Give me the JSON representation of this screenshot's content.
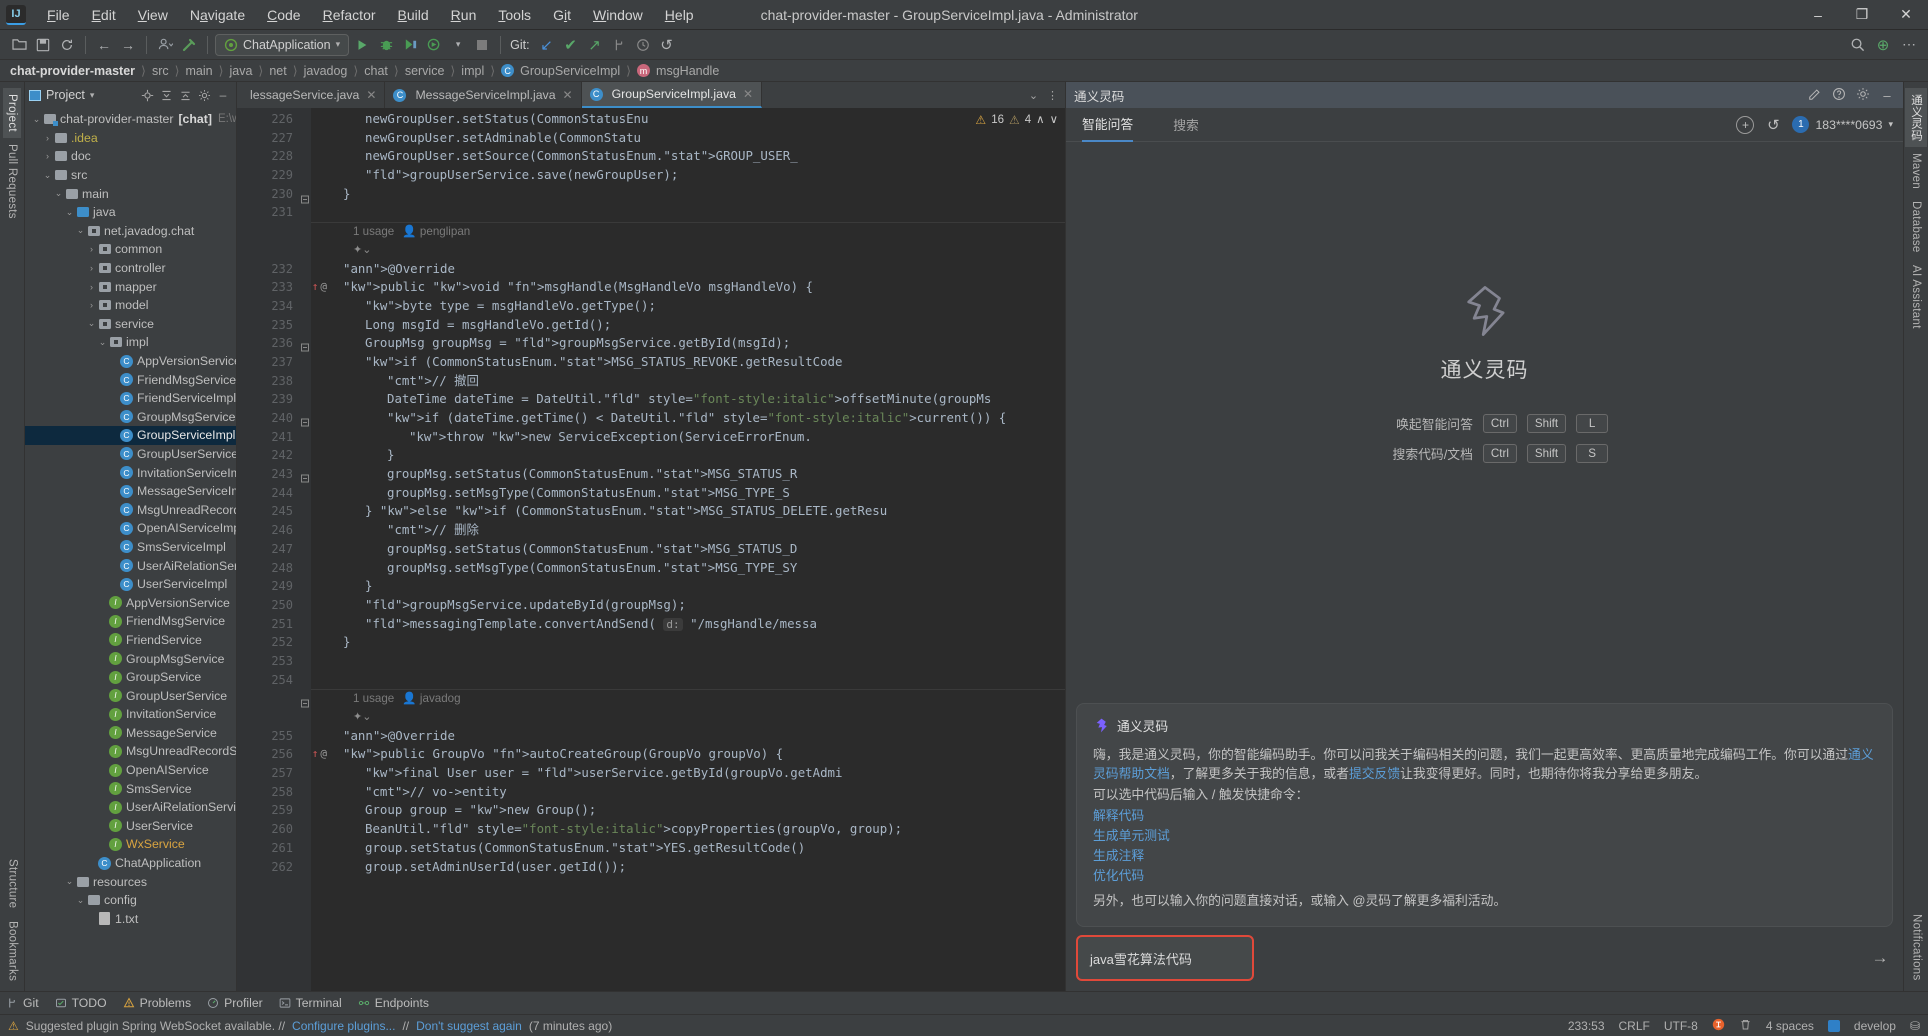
{
  "titlebar": {
    "menus": [
      "File",
      "Edit",
      "View",
      "Navigate",
      "Code",
      "Refactor",
      "Build",
      "Run",
      "Tools",
      "Git",
      "Window",
      "Help"
    ],
    "window_title": "chat-provider-master - GroupServiceImpl.java - Administrator",
    "minimize": "–",
    "maximize": "❐",
    "close": "✕",
    "logo": "IJ"
  },
  "toolbar": {
    "open_icon": "open-folder-icon",
    "save_icon": "save-icon",
    "sync_icon": "sync-icon",
    "back_icon": "←",
    "forward_icon": "→",
    "profile_icon": "user-icon",
    "build_icon": "hammer-icon",
    "run_config": "ChatApplication",
    "run_icon": "▶",
    "debug_icon": "debug-icon",
    "run_coverage_icon": "coverage-icon",
    "profile_run_icon": "profiler-icon",
    "stop_icon": "■",
    "git_label": "Git:",
    "git_update_icon": "↙",
    "git_commit_icon": "✔",
    "git_push_icon": "↗",
    "git_branch_icon": "branch-icon",
    "git_history_icon": "history-icon",
    "git_rollback_icon": "↺",
    "search_icon": "⌕",
    "plus_icon": "⊕",
    "more_icon": "⋯"
  },
  "breadcrumb": {
    "items": [
      {
        "label": "chat-provider-master",
        "icon": ""
      },
      {
        "label": "src",
        "icon": ""
      },
      {
        "label": "main",
        "icon": ""
      },
      {
        "label": "java",
        "icon": ""
      },
      {
        "label": "net",
        "icon": ""
      },
      {
        "label": "javadog",
        "icon": ""
      },
      {
        "label": "chat",
        "icon": ""
      },
      {
        "label": "service",
        "icon": ""
      },
      {
        "label": "impl",
        "icon": ""
      },
      {
        "label": "GroupServiceImpl",
        "icon": "class-icon"
      },
      {
        "label": "msgHandle",
        "icon": "method-icon"
      }
    ]
  },
  "left_rail": {
    "items": [
      "Project",
      "Pull Requests"
    ],
    "bottom_items": [
      "Structure",
      "Bookmarks"
    ]
  },
  "right_rail": {
    "items": [
      "通义灵码",
      "Maven",
      "Database",
      "AI Assistant"
    ],
    "bottom_items": [
      "Notifications"
    ]
  },
  "project_panel": {
    "title": "Project",
    "dropdown_icon": "▾",
    "locate_icon": "crosshair-icon",
    "expand_icon": "expand-all-icon",
    "collapse_icon": "collapse-all-icon",
    "settings_icon": "gear-icon",
    "hide_icon": "–",
    "tree": [
      {
        "depth": 0,
        "arrow": "⌄",
        "icon": "module",
        "label": "chat-provider-master",
        "bold_suffix": "[chat]",
        "path": "E:\\workgi",
        "sel": false
      },
      {
        "depth": 1,
        "arrow": "›",
        "icon": "folder",
        "label": ".idea",
        "color": "yellowish",
        "sel": false
      },
      {
        "depth": 1,
        "arrow": "›",
        "icon": "folder",
        "label": "doc",
        "sel": false
      },
      {
        "depth": 1,
        "arrow": "⌄",
        "icon": "folder",
        "label": "src",
        "sel": false
      },
      {
        "depth": 2,
        "arrow": "⌄",
        "icon": "folder",
        "label": "main",
        "sel": false
      },
      {
        "depth": 3,
        "arrow": "⌄",
        "icon": "src",
        "label": "java",
        "sel": false
      },
      {
        "depth": 4,
        "arrow": "⌄",
        "icon": "pkg",
        "label": "net.javadog.chat",
        "sel": false
      },
      {
        "depth": 5,
        "arrow": "›",
        "icon": "pkg",
        "label": "common",
        "sel": false
      },
      {
        "depth": 5,
        "arrow": "›",
        "icon": "pkg",
        "label": "controller",
        "sel": false
      },
      {
        "depth": 5,
        "arrow": "›",
        "icon": "pkg",
        "label": "mapper",
        "sel": false
      },
      {
        "depth": 5,
        "arrow": "›",
        "icon": "pkg",
        "label": "model",
        "sel": false
      },
      {
        "depth": 5,
        "arrow": "⌄",
        "icon": "pkg",
        "label": "service",
        "sel": false
      },
      {
        "depth": 6,
        "arrow": "⌄",
        "icon": "pkg",
        "label": "impl",
        "sel": false
      },
      {
        "depth": 7,
        "arrow": "",
        "icon": "class",
        "label": "AppVersionServiceImpl",
        "sel": false
      },
      {
        "depth": 7,
        "arrow": "",
        "icon": "class",
        "label": "FriendMsgServiceImpl",
        "sel": false
      },
      {
        "depth": 7,
        "arrow": "",
        "icon": "class",
        "label": "FriendServiceImpl",
        "sel": false
      },
      {
        "depth": 7,
        "arrow": "",
        "icon": "class",
        "label": "GroupMsgServiceImpl",
        "sel": false
      },
      {
        "depth": 7,
        "arrow": "",
        "icon": "class",
        "label": "GroupServiceImpl",
        "sel": true
      },
      {
        "depth": 7,
        "arrow": "",
        "icon": "class",
        "label": "GroupUserServiceImpl",
        "sel": false
      },
      {
        "depth": 7,
        "arrow": "",
        "icon": "class",
        "label": "InvitationServiceImpl",
        "sel": false
      },
      {
        "depth": 7,
        "arrow": "",
        "icon": "class",
        "label": "MessageServiceImpl",
        "sel": false
      },
      {
        "depth": 7,
        "arrow": "",
        "icon": "class",
        "label": "MsgUnreadRecordServiceImpl",
        "sel": false
      },
      {
        "depth": 7,
        "arrow": "",
        "icon": "class",
        "label": "OpenAIServiceImpl",
        "sel": false
      },
      {
        "depth": 7,
        "arrow": "",
        "icon": "class",
        "label": "SmsServiceImpl",
        "sel": false
      },
      {
        "depth": 7,
        "arrow": "",
        "icon": "class",
        "label": "UserAiRelationServiceImpl",
        "sel": false
      },
      {
        "depth": 7,
        "arrow": "",
        "icon": "class",
        "label": "UserServiceImpl",
        "sel": false
      },
      {
        "depth": 6,
        "arrow": "",
        "icon": "interface",
        "label": "AppVersionService",
        "sel": false
      },
      {
        "depth": 6,
        "arrow": "",
        "icon": "interface",
        "label": "FriendMsgService",
        "sel": false
      },
      {
        "depth": 6,
        "arrow": "",
        "icon": "interface",
        "label": "FriendService",
        "sel": false
      },
      {
        "depth": 6,
        "arrow": "",
        "icon": "interface",
        "label": "GroupMsgService",
        "sel": false
      },
      {
        "depth": 6,
        "arrow": "",
        "icon": "interface",
        "label": "GroupService",
        "sel": false
      },
      {
        "depth": 6,
        "arrow": "",
        "icon": "interface",
        "label": "GroupUserService",
        "sel": false
      },
      {
        "depth": 6,
        "arrow": "",
        "icon": "interface",
        "label": "InvitationService",
        "sel": false
      },
      {
        "depth": 6,
        "arrow": "",
        "icon": "interface",
        "label": "MessageService",
        "sel": false
      },
      {
        "depth": 6,
        "arrow": "",
        "icon": "interface",
        "label": "MsgUnreadRecordService",
        "sel": false
      },
      {
        "depth": 6,
        "arrow": "",
        "icon": "interface",
        "label": "OpenAIService",
        "sel": false
      },
      {
        "depth": 6,
        "arrow": "",
        "icon": "interface",
        "label": "SmsService",
        "sel": false
      },
      {
        "depth": 6,
        "arrow": "",
        "icon": "interface",
        "label": "UserAiRelationService",
        "sel": false
      },
      {
        "depth": 6,
        "arrow": "",
        "icon": "interface",
        "label": "UserService",
        "sel": false
      },
      {
        "depth": 6,
        "arrow": "",
        "icon": "interface",
        "label": "WxService",
        "color": "orange",
        "sel": false
      },
      {
        "depth": 5,
        "arrow": "",
        "icon": "class",
        "label": "ChatApplication",
        "sel": false
      },
      {
        "depth": 3,
        "arrow": "⌄",
        "icon": "folder",
        "label": "resources",
        "sel": false
      },
      {
        "depth": 4,
        "arrow": "⌄",
        "icon": "folder",
        "label": "config",
        "sel": false
      },
      {
        "depth": 5,
        "arrow": "",
        "icon": "file",
        "label": "1.txt",
        "sel": false
      }
    ]
  },
  "editor": {
    "tabs": [
      {
        "label": "lessageService.java",
        "icon": "interface-icon",
        "active": false
      },
      {
        "label": "MessageServiceImpl.java",
        "icon": "class-icon",
        "active": false
      },
      {
        "label": "GroupServiceImpl.java",
        "icon": "class-icon",
        "active": true
      }
    ],
    "tab_more_icon": "⌄",
    "tab_menu_icon": "⋮",
    "inspection": {
      "warning_count": "16",
      "weak_warning_count": "4",
      "up_icon": "∧",
      "down_icon": "∨"
    },
    "lines": [
      {
        "num": "226",
        "indent": 2,
        "code": "newGroupUser.setStatus(CommonStatusEnu"
      },
      {
        "num": "227",
        "indent": 2,
        "code": "newGroupUser.setAdminable(CommonStatu"
      },
      {
        "num": "228",
        "indent": 2,
        "code": "newGroupUser.setSource(CommonStatusEnum.GROUP_USER_"
      },
      {
        "num": "229",
        "indent": 2,
        "code": "groupUserService.save(newGroupUser);"
      },
      {
        "num": "230",
        "indent": 1,
        "code": "}"
      },
      {
        "num": "231",
        "indent": 0,
        "code": ""
      },
      {
        "num": "hint",
        "usage": "1 usage",
        "author": "penglipan"
      },
      {
        "num": "232",
        "indent": 1,
        "code": "@Override"
      },
      {
        "num": "233",
        "indent": 1,
        "code": "public void msgHandle(MsgHandleVo msgHandleVo) {"
      },
      {
        "num": "234",
        "indent": 2,
        "code": "byte type = msgHandleVo.getType();"
      },
      {
        "num": "235",
        "indent": 2,
        "code": "Long msgId = msgHandleVo.getId();"
      },
      {
        "num": "236",
        "indent": 2,
        "code": "GroupMsg groupMsg = groupMsgService.getById(msgId);"
      },
      {
        "num": "237",
        "indent": 2,
        "code": "if (CommonStatusEnum.MSG_STATUS_REVOKE.getResultCode"
      },
      {
        "num": "238",
        "indent": 3,
        "code": "// 撤回"
      },
      {
        "num": "239",
        "indent": 3,
        "code": "DateTime dateTime = DateUtil.offsetMinute(groupMs"
      },
      {
        "num": "240",
        "indent": 3,
        "code": "if (dateTime.getTime() < DateUtil.current()) {"
      },
      {
        "num": "241",
        "indent": 4,
        "code": "throw new ServiceException(ServiceErrorEnum."
      },
      {
        "num": "242",
        "indent": 3,
        "code": "}"
      },
      {
        "num": "243",
        "indent": 3,
        "code": "groupMsg.setStatus(CommonStatusEnum.MSG_STATUS_R"
      },
      {
        "num": "244",
        "indent": 3,
        "code": "groupMsg.setMsgType(CommonStatusEnum.MSG_TYPE_S"
      },
      {
        "num": "245",
        "indent": 2,
        "code": "} else if (CommonStatusEnum.MSG_STATUS_DELETE.getResu"
      },
      {
        "num": "246",
        "indent": 3,
        "code": "// 删除"
      },
      {
        "num": "247",
        "indent": 3,
        "code": "groupMsg.setStatus(CommonStatusEnum.MSG_STATUS_D"
      },
      {
        "num": "248",
        "indent": 3,
        "code": "groupMsg.setMsgType(CommonStatusEnum.MSG_TYPE_SY"
      },
      {
        "num": "249",
        "indent": 2,
        "code": "}"
      },
      {
        "num": "250",
        "indent": 2,
        "code": "groupMsgService.updateById(groupMsg);"
      },
      {
        "num": "251",
        "indent": 2,
        "code": "messagingTemplate.convertAndSend( d: \"/msgHandle/messa"
      },
      {
        "num": "252",
        "indent": 1,
        "code": "}"
      },
      {
        "num": "253",
        "indent": 0,
        "code": ""
      },
      {
        "num": "254",
        "indent": 0,
        "code": ""
      },
      {
        "num": "hint2",
        "usage": "1 usage",
        "author": "javadog"
      },
      {
        "num": "255",
        "indent": 1,
        "code": "@Override"
      },
      {
        "num": "256",
        "indent": 1,
        "code": "public GroupVo autoCreateGroup(GroupVo groupVo) {"
      },
      {
        "num": "257",
        "indent": 2,
        "code": "final User user = userService.getById(groupVo.getAdmi"
      },
      {
        "num": "258",
        "indent": 2,
        "code": "// vo->entity"
      },
      {
        "num": "259",
        "indent": 2,
        "code": "Group group = new Group();"
      },
      {
        "num": "260",
        "indent": 2,
        "code": "BeanUtil.copyProperties(groupVo, group);"
      },
      {
        "num": "261",
        "indent": 2,
        "code": "group.setStatus(CommonStatusEnum.YES.getResultCode()"
      },
      {
        "num": "262",
        "indent": 2,
        "code": "group.setAdminUserId(user.getId());"
      }
    ]
  },
  "ai_panel": {
    "header_title": "通义灵码",
    "header_icons": [
      "edit-icon",
      "help-icon",
      "gear-icon",
      "minimize-icon"
    ],
    "tabs": [
      {
        "label": "智能问答",
        "active": true
      },
      {
        "label": "搜索",
        "active": false
      }
    ],
    "new_chat_icon": "⊕",
    "history_icon": "↺",
    "account": "183****0693",
    "account_badge": "1",
    "account_chevron": "▾",
    "hero": {
      "title": "通义灵码",
      "rows": [
        {
          "label": "唤起智能问答",
          "keys": [
            "Ctrl",
            "Shift",
            "L"
          ]
        },
        {
          "label": "搜索代码/文档",
          "keys": [
            "Ctrl",
            "Shift",
            "S"
          ]
        }
      ]
    },
    "message": {
      "name": "通义灵码",
      "paragraph_1a": "嗨，我是通义灵码，你的智能编码助手。你可以问我关于编码相关的问题，我们一起更高效率、更高质量地完成编码工作。你可以通过",
      "link_1": "通义灵码帮助文档",
      "paragraph_1b": "，了解更多关于我的信息，或者",
      "link_2": "提交反馈",
      "paragraph_1c": "让我变得更好。同时，也期待你将我分享给更多朋友。",
      "paragraph_2": "可以选中代码后输入 / 触发快捷命令：",
      "commands": [
        "解释代码",
        "生成单元测试",
        "生成注释",
        "优化代码"
      ],
      "tail": "另外，也可以输入你的问题直接对话，或输入 @灵码了解更多福利活动。"
    },
    "input": {
      "value": "java雪花算法代码",
      "send_icon": "→"
    },
    "highlight_color": "#e0493a"
  },
  "toolwindow_bar": {
    "items": [
      {
        "label": "Git",
        "icon": "git-icon"
      },
      {
        "label": "TODO",
        "icon": "todo-icon"
      },
      {
        "label": "Problems",
        "icon": "problems-icon"
      },
      {
        "label": "Profiler",
        "icon": "profiler-icon"
      },
      {
        "label": "Terminal",
        "icon": "terminal-icon"
      },
      {
        "label": "Endpoints",
        "icon": "endpoints-icon"
      }
    ]
  },
  "statusbar": {
    "message_prefix": "Suggested plugin Spring WebSocket available. //",
    "link_1": "Configure plugins...",
    "separator": "//",
    "link_2": "Don't suggest again",
    "suffix": "(7 minutes ago)",
    "caret": "233:53",
    "line_separator": "CRLF",
    "encoding": "UTF-8",
    "indent": "4 spaces",
    "branch": "develop",
    "lock_icon": "⛁",
    "trash_icon": "trash-icon",
    "warn_icon": "warning-icon",
    "brand_icon": "idea-icon"
  }
}
